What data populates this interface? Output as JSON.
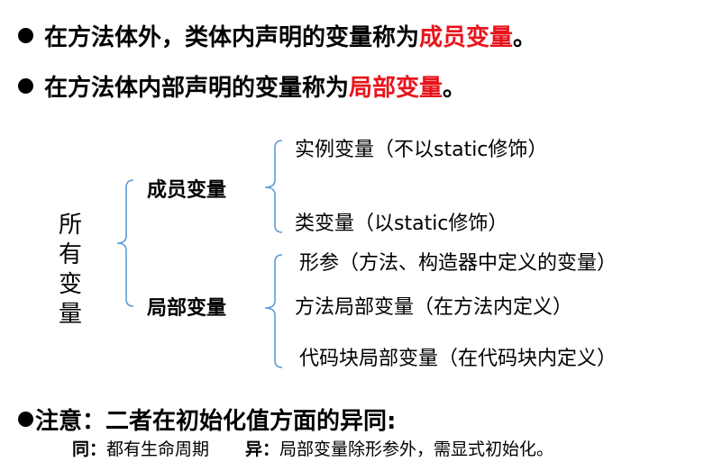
{
  "bullets": [
    {
      "text": "在方法体外，类体内声明的变量称为",
      "highlight": "成员变量",
      "end": "。"
    },
    {
      "text": "在方法体内部声明的变量称为",
      "highlight": "局部变量",
      "end": "。"
    }
  ],
  "tree": {
    "root": [
      "所",
      "有",
      "变",
      "量"
    ],
    "member": {
      "label": "成员变量",
      "items": [
        "实例变量（不以static修饰）",
        "类变量（以static修饰）"
      ]
    },
    "local": {
      "label": "局部变量",
      "items": [
        "形参（方法、构造器中定义的变量）",
        "方法局部变量（在方法内定义）",
        "代码块局部变量（在代码块内定义）"
      ]
    }
  },
  "note": {
    "bullet_text": "注意：二者在初始化值方面的异同:",
    "same_label": "同：",
    "same_text": "都有生命周期",
    "diff_label": "异：",
    "diff_text": "局部变量除形参外，需显式初始化。"
  },
  "colors": {
    "highlight": "#e8141c",
    "bracket": "#5b9bd5"
  }
}
